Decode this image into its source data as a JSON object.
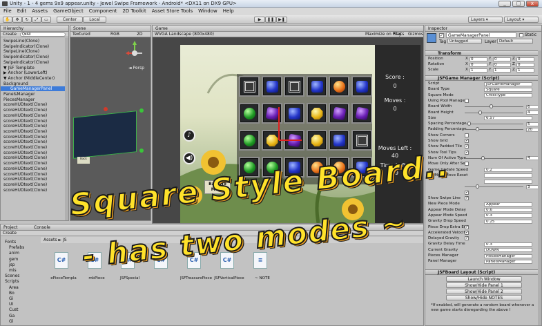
{
  "window": {
    "title": "Unity - 1 - 4 gems 9x9 appear.unity - Jewel Swipe Framework - Android* <DX11 on DX9 GPU>"
  },
  "menu": [
    "File",
    "Edit",
    "Assets",
    "GameObject",
    "Component",
    "2D Toolkit",
    "Asset Store Tools",
    "Window",
    "Help"
  ],
  "toolbar": {
    "center": "Center",
    "local": "Local",
    "layers": "Layers",
    "layout": "Layout"
  },
  "hierarchy": {
    "tab": "Hierarchy",
    "create": "Create",
    "search": "Q▾All",
    "items": [
      "SwipeLine(Clone)",
      "SwipeIndicator(Clone)",
      "SwipeLine(Clone)",
      "SwipeIndicator(Clone)",
      "SwipeIndicator(Clone)",
      "▼ JSF Template",
      "  ▶ Anchor (LowerLeft)",
      "  ▼ Anchor (MiddleCenter)",
      "      Background",
      "GameManagerPanel",
      "      PanelsManager",
      "      PiecesManager",
      "      scoreHUDtext(Clone)",
      "      scoreHUDtext(Clone)",
      "      scoreHUDtext(Clone)",
      "      scoreHUDtext(Clone)",
      "      scoreHUDtext(Clone)",
      "      scoreHUDtext(Clone)",
      "      scoreHUDtext(Clone)",
      "      scoreHUDtext(Clone)",
      "      scoreHUDtext(Clone)",
      "      scoreHUDtext(Clone)",
      "      scoreHUDtext(Clone)",
      "      scoreHUDtext(Clone)",
      "      scoreHUDtext(Clone)",
      "      scoreHUDtext(Clone)",
      "      scoreHUDtext(Clone)",
      "      scoreHUDtext(Clone)",
      "      scoreHUDtext(Clone)"
    ]
  },
  "scene": {
    "tab": "Scene",
    "shading": "Textured",
    "rgb": "RGB",
    "mode2d": "2D",
    "persp": "◄ Persp"
  },
  "game": {
    "tab": "Game",
    "resolution": "WVGA Landscape (800x480)",
    "maximize": "Maximize on Play",
    "stats": "Stats",
    "gizmos": "Gizmos"
  },
  "board": {
    "rows": [
      [
        "g-box",
        "g-blue",
        "g-box",
        "g-blue",
        "g-orange",
        "g-blue"
      ],
      [
        "g-green",
        "g-purple",
        "g-blue",
        "g-yellow",
        "g-purple",
        "g-purple"
      ],
      [
        "g-green",
        "g-yellow",
        "g-purple",
        "g-yellow",
        "g-blue",
        "g-box"
      ],
      [
        "g-green",
        "g-green",
        "g-blue",
        "g-orange",
        "g-orange",
        "g-blue"
      ]
    ],
    "score_label": "Score :",
    "score": "0",
    "moves_label": "Moves :",
    "moves": "0",
    "moves_left_label": "Moves Left :",
    "moves_left": "40",
    "time_left_label": "Time Left :",
    "time_left": "99",
    "back_button": "Back To Menu"
  },
  "inspector": {
    "tab": "Inspector",
    "object_name": "GameManagerPanel",
    "static": "Static",
    "tag_label": "Tag",
    "tag": "Untagged",
    "layer_label": "Layer",
    "layer": "Default",
    "transform": {
      "title": "Transform",
      "rows": [
        {
          "label": "Position",
          "x": "0",
          "y": "0",
          "z": "0"
        },
        {
          "label": "Rotation",
          "x": "0",
          "y": "0",
          "z": "0"
        },
        {
          "label": "Scale",
          "x": "1",
          "y": "1",
          "z": "1"
        }
      ]
    },
    "manager_title": "JSFGame Manager (Script)",
    "fields": [
      {
        "k": "Script",
        "v": "JSFGameManager"
      },
      {
        "k": "Board Type",
        "v": "Square"
      },
      {
        "k": "Square Mode",
        "v": "CrossType"
      },
      {
        "k": "Using Pool Manager",
        "cb": false
      },
      {
        "k": "Board Width",
        "num": "6",
        "knob": 0.45
      },
      {
        "k": "Board Height",
        "num": "4",
        "knob": 0.25
      },
      {
        "k": "Size",
        "v": "6.57"
      },
      {
        "k": "Spacing Percentage",
        "num": "5",
        "knob": 0.05
      },
      {
        "k": "Padding Percentage",
        "num": "20",
        "knob": 0.2
      },
      {
        "k": "Show Corners",
        "cb": false
      },
      {
        "k": "Show Grid",
        "cb": true
      },
      {
        "k": "Show Padded Tile",
        "cb": true
      },
      {
        "k": "Show Tool Tips",
        "cb": true
      },
      {
        "k": "Num Of Active Type",
        "num": "4",
        "knob": 0.3
      },
      {
        "k": "Move Only After Sett",
        "cb": false
      },
      {
        "k": "Game Update Speed",
        "v": "0.2"
      },
      {
        "k": "No More Move Reset",
        "v": ""
      },
      {
        "k": "",
        "v": ""
      },
      {
        "k": "",
        "num": "3",
        "knob": 0.2
      },
      {
        "k": "",
        "cb": true
      },
      {
        "k": "Show Swipe Line",
        "cb": true
      },
      {
        "k": "New Piece Mode",
        "v": "Appear"
      },
      {
        "k": "Appear Mode Delay",
        "v": "0.6"
      },
      {
        "k": "Appear Mode Speed",
        "v": "0.3"
      },
      {
        "k": "Gravity Drop Speed",
        "v": "0.25"
      },
      {
        "k": "Piece Drop Extra Eff",
        "cb": true
      },
      {
        "k": "Accelerated Velocity",
        "cb": true
      },
      {
        "k": "Delayed Gravity",
        "cb": true
      },
      {
        "k": "Gravity Delay Time",
        "v": "0.3"
      },
      {
        "k": "Current Gravity",
        "v": "DOWN"
      },
      {
        "k": "Pieces Manager",
        "v": "PiecesManager"
      },
      {
        "k": "Panel Manager",
        "v": "PanelsManager"
      }
    ],
    "layout_title": "JSFBoard Layout (Script)",
    "buttons": [
      "Launch Window",
      "Show/Hide Panel 1",
      "Show/Hide Panel 2",
      "Show/Hide NOTES"
    ],
    "note": "*If enabled, will generate a random board whenever a new game starts disregarding the above l"
  },
  "project": {
    "tab": "Project",
    "console_tab": "Console",
    "create": "Create",
    "breadcrumb": "Assets ► JS",
    "tree": [
      "Fonts",
      "Prefabs",
      "anim",
      "gem",
      "jsp",
      "mis",
      "Scenes",
      "Scripts",
      "Area",
      "Bo",
      "Gi",
      "UI",
      "Cust",
      "Ga",
      "Gl"
    ],
    "assets": [
      "ePieceTempla",
      "mbPiece",
      "JSFSpecial",
      "",
      "JSFTreasurePiece",
      "JSFVerticalPiece",
      "~ NOTE"
    ]
  },
  "overlay": {
    "line1": "Square Style Board..",
    "line2": "- has two modes ~"
  }
}
